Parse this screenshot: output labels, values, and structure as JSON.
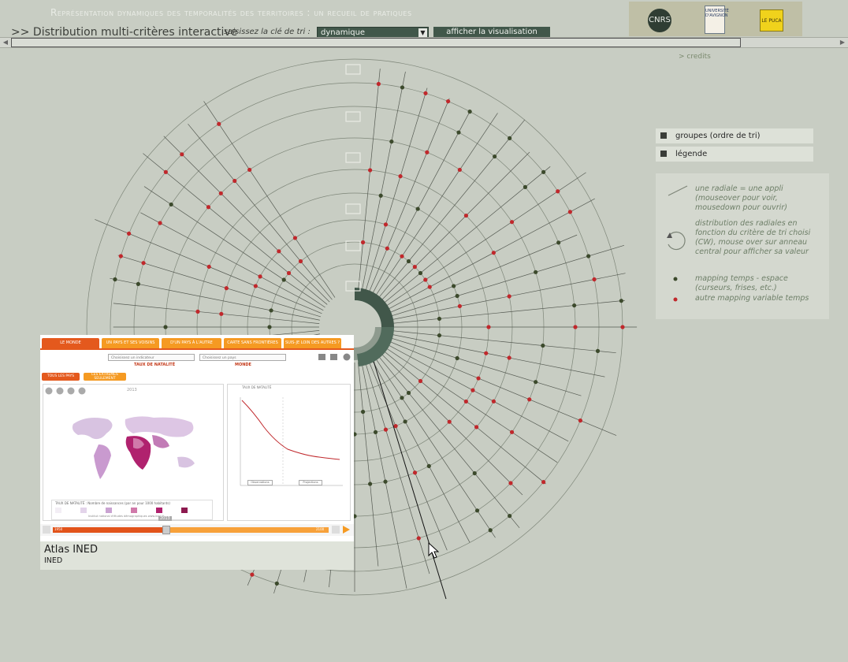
{
  "header": {
    "title": "Représentation dynamiques des temporalités des territoires : un recueil de pratiques",
    "subtitle": ">> Distribution multi-critères interactive",
    "sort_key_label": "saisissez la clé de tri :",
    "sort_key_value": "dynamique",
    "show_button": "afficher la visualisation"
  },
  "logos": {
    "left": "CNRS",
    "middle": "UNIVERSITÉ D'AVIGNON",
    "right": "LE PUCA"
  },
  "credits": "> credits",
  "side_panel": {
    "groups_label": "groupes (ordre de tri)",
    "legend_label": "légende"
  },
  "legend": {
    "radial_text": "une radiale = une appli (mouseover pour voir, mousedown pour ouvrir)",
    "distribution_text": "distribution des radiales en fonction du critère de tri choisi (CW), mouse over sur anneau central pour afficher sa valeur",
    "green_text": "mapping temps - espace (curseurs, frises, etc.)",
    "red_text": "autre mapping variable temps"
  },
  "colors": {
    "background": "#c8cdc3",
    "green_dot": "#3c4a2c",
    "red_dot": "#c0282c",
    "ring_dark": "#41574a",
    "ring_light": "#8e9a8e"
  },
  "preview": {
    "tabs": [
      "LE MONDE",
      "UN PAYS ET SES VOISINS",
      "D'UN PAYS À L'AUTRE",
      "CARTE SANS FRONTIÈRES",
      "SUIS-JE LOIN DES AUTRES ?"
    ],
    "indicator_select": "Choisissez un indicateur",
    "country_select": "Choisissez un pays",
    "indicator_title": "TAUX DE NATALITÉ",
    "region_title": "MONDE",
    "pill_all": "TOUS LES PAYS",
    "pill_extremes": "LES EXTRÊMES SEULEMENT",
    "map_year": "2013",
    "chart_title": "TAUX DE NATALITÉ",
    "obs_label": "Observations",
    "proj_label": "Projections",
    "timeline_start": "1950",
    "timeline_end": "2100",
    "timeline_year": "2013",
    "legend_title": "TAUX DE NATALITÉ : Nombre de naissances (par an pour 1000 habitants)",
    "footer": "Institut national d'études démographiques www.ined.fr"
  },
  "caption": {
    "title": "Atlas INED",
    "author": "INED"
  }
}
